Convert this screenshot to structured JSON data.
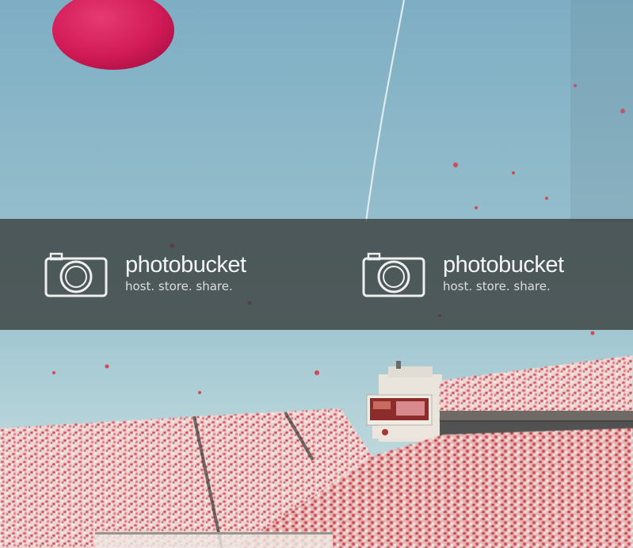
{
  "photo": {
    "description_icons": [
      "balloon",
      "contrail",
      "stadium-crowd",
      "scoreboard"
    ]
  },
  "watermark": {
    "brand": "photobucket",
    "tagline": "host. store. share.",
    "icon": "camera-icon"
  },
  "colors": {
    "sky_top": "#89b3c6",
    "sky_bottom": "#bfd9de",
    "balloon": "#d81e5c",
    "crowd_red": "#d8505c",
    "crowd_white": "#f3e6e3",
    "band": "#3a3e3c"
  }
}
